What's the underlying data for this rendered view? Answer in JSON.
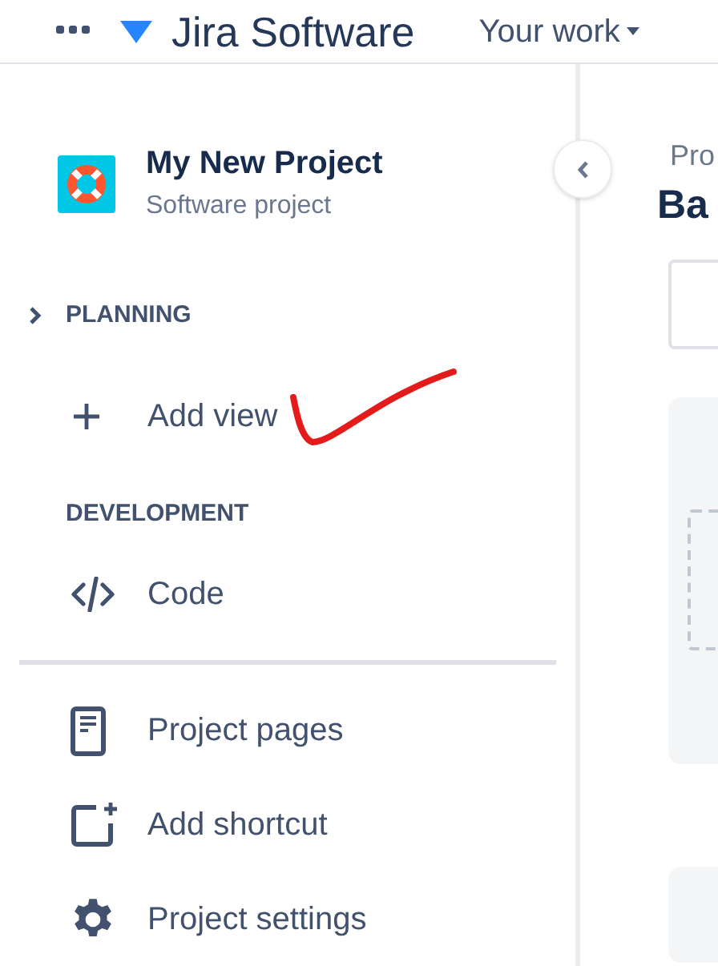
{
  "top_nav": {
    "product": "Jira Software",
    "menu": "Your work"
  },
  "project": {
    "name": "My New Project",
    "type": "Software project"
  },
  "sections": [
    {
      "title": "PLANNING",
      "kind": "toggle",
      "items": [
        {
          "label": "Add view",
          "kind": "plus"
        }
      ]
    },
    {
      "title": "DEVELOPMENT",
      "kind": "plain",
      "items": [
        {
          "label": "Code",
          "kind": "code"
        }
      ]
    }
  ],
  "footer_items": [
    {
      "label": "Project pages",
      "kind": "page"
    },
    {
      "label": "Add shortcut",
      "kind": "shortcut"
    },
    {
      "label": "Project settings",
      "kind": "gear"
    }
  ],
  "main": {
    "breadcrumb": "Pro",
    "title": "Ba"
  }
}
